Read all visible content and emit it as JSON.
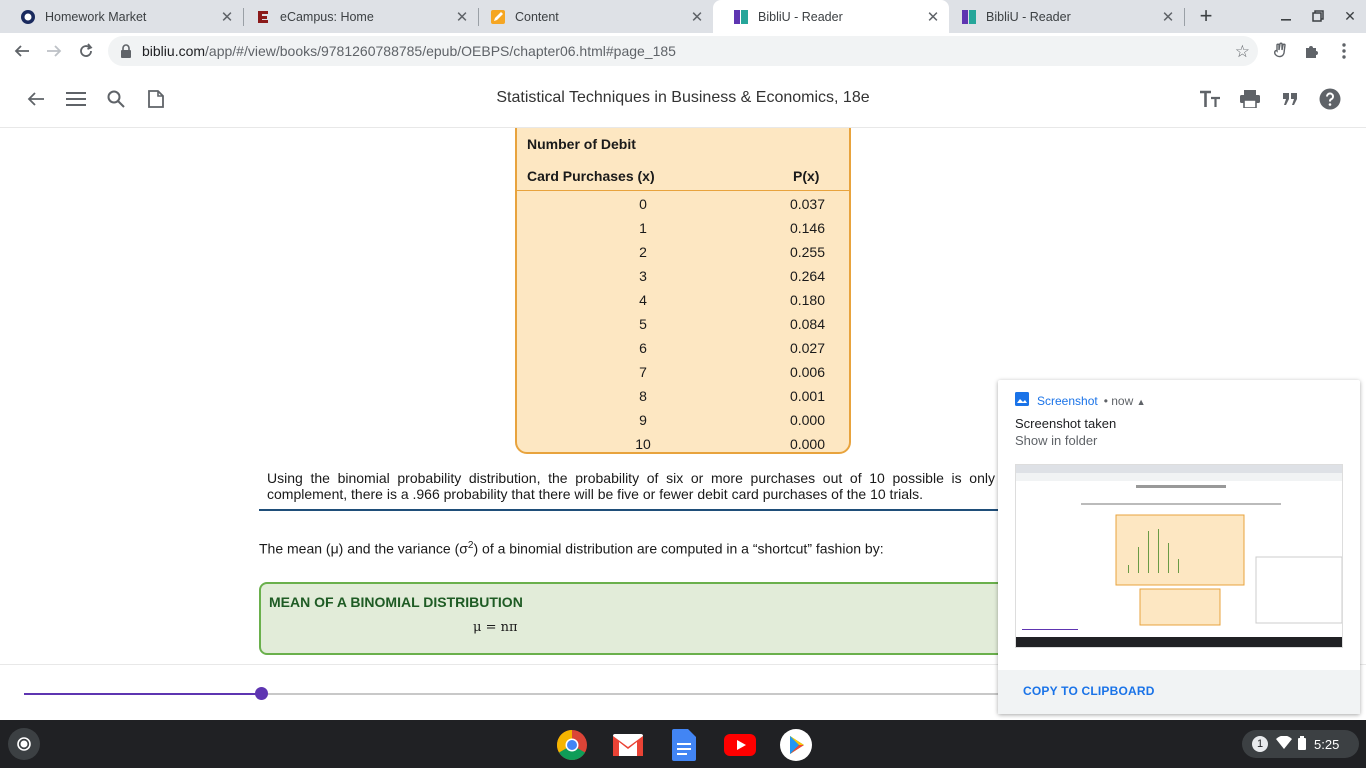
{
  "browser": {
    "tabs": [
      {
        "title": "Homework Market",
        "active": false
      },
      {
        "title": "eCampus: Home",
        "active": false
      },
      {
        "title": "Content",
        "active": false
      },
      {
        "title": "BibliU - Reader",
        "active": true
      },
      {
        "title": "BibliU - Reader",
        "active": false
      }
    ],
    "url_host": "bibliu.com",
    "url_path": "/app/#/view/books/9781260788785/epub/OEBPS/chapter06.html#page_185"
  },
  "reader": {
    "book_title": "Statistical Techniques in Business & Economics, 18e"
  },
  "table": {
    "header_line1": "Number of Debit",
    "header_col1": "Card Purchases (x)",
    "header_col2": "P(x)",
    "rows": [
      {
        "x": "0",
        "p": "0.037"
      },
      {
        "x": "1",
        "p": "0.146"
      },
      {
        "x": "2",
        "p": "0.255"
      },
      {
        "x": "3",
        "p": "0.264"
      },
      {
        "x": "4",
        "p": "0.180"
      },
      {
        "x": "5",
        "p": "0.084"
      },
      {
        "x": "6",
        "p": "0.027"
      },
      {
        "x": "7",
        "p": "0.006"
      },
      {
        "x": "8",
        "p": "0.001"
      },
      {
        "x": "9",
        "p": "0.000"
      },
      {
        "x": "10",
        "p": "0.000"
      }
    ]
  },
  "content": {
    "paragraph1": "Using the binomial probability distribution, the probability of six or more purchases out of 10 possible is only complement, there is a .966 probability that there will be five or fewer debit card purchases of the 10 trials.",
    "paragraph2_before": "The mean (μ) and the variance (σ",
    "paragraph2_sup": "2",
    "paragraph2_after": ") of a binomial distribution are computed in a “shortcut” fashion by:",
    "mean_box_title": "MEAN OF A BINOMIAL DISTRIBUTION",
    "mean_formula": "μ = nπ"
  },
  "progress": {
    "fraction": 0.18
  },
  "notification": {
    "app": "Screenshot",
    "time": "now",
    "title": "Screenshot taken",
    "subtitle": "Show in folder",
    "action": "COPY TO CLIPBOARD"
  },
  "shelf": {
    "notification_count": "1",
    "clock": "5:25"
  },
  "colors": {
    "accent_purple": "#5e35b1",
    "table_fill": "#fde7c2",
    "table_border": "#e8a33d",
    "mean_fill": "#e2ecd9",
    "mean_border": "#6ab04c",
    "link_blue": "#1a73e8"
  }
}
